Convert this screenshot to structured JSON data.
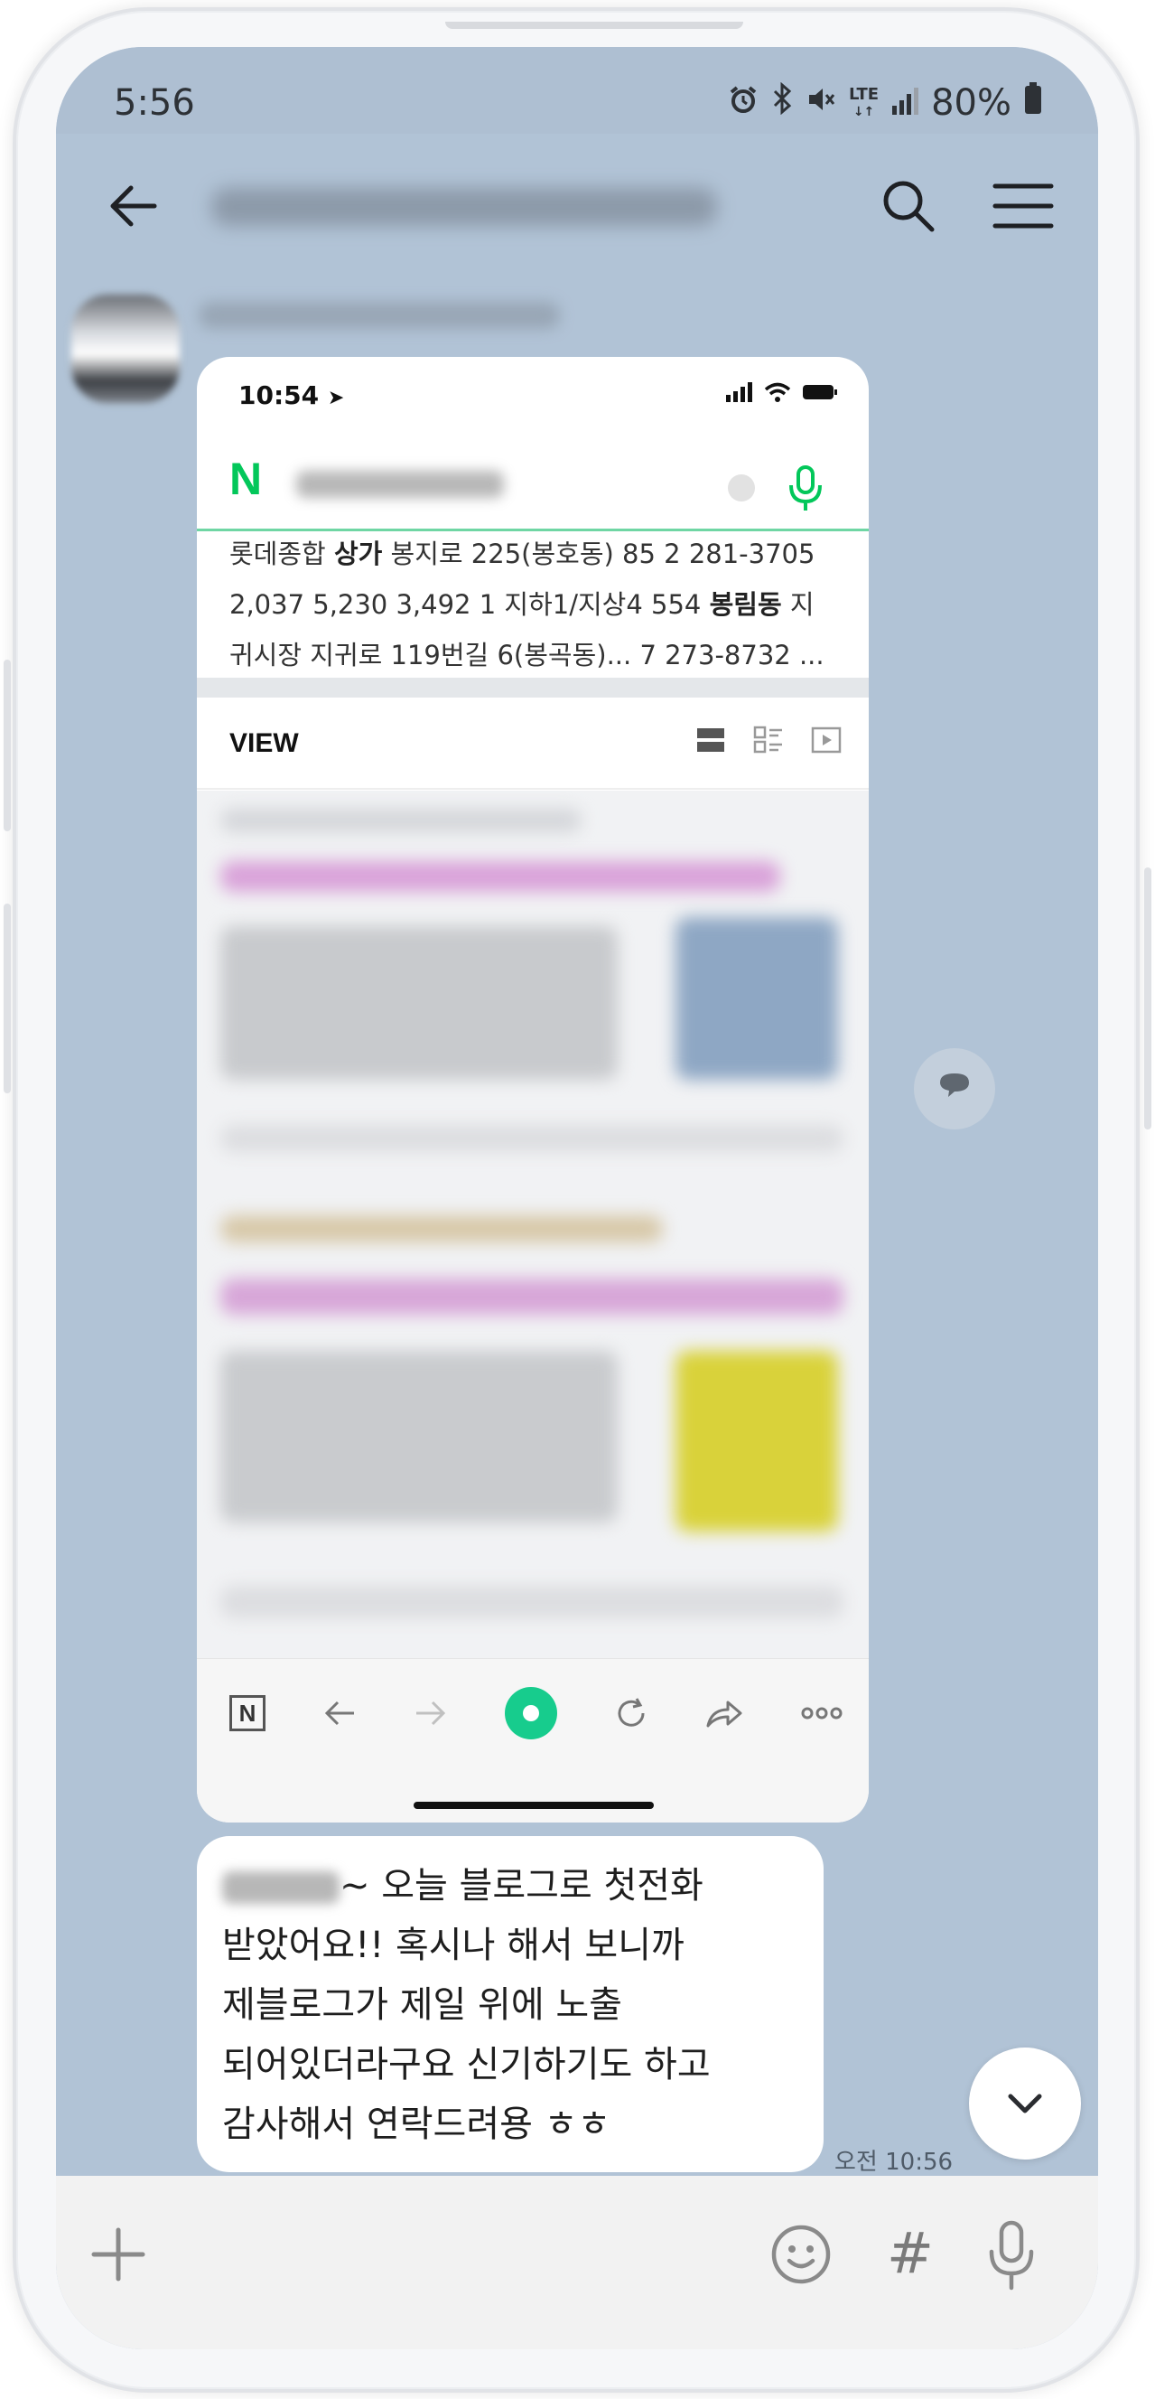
{
  "status_bar": {
    "time": "5:56",
    "network": "LTE",
    "battery": "80%"
  },
  "screenshot": {
    "status_time": "10:54",
    "search_logo": "N",
    "result_lines": [
      {
        "text_before": "롯데종합 ",
        "bold": "상가",
        "text_after": " 봉지로 225(봉호동) 85 2 281-3705"
      },
      {
        "text_before": "2,037 5,230 3,492 1 지하1/지상4 554 ",
        "bold": "봉림동",
        "text_after": " 지"
      },
      {
        "text_before": "귀시장 지귀로 119번길 6(봉곡동)... 7 273-8732 ...",
        "bold": "",
        "text_after": ""
      }
    ],
    "view_label": "VIEW",
    "bottom_logo": "N"
  },
  "message": {
    "lines": [
      "~ 오늘 블로그로 첫전화",
      "받았어요!! 혹시나 해서 보니까",
      "제블로그가 제일 위에 노출",
      "되어있더라구요 신기하기도 하고",
      "감사해서 연락드려용 ㅎㅎ"
    ],
    "timestamp": "오전 10:56"
  },
  "input_bar": {
    "hash_symbol": "#"
  },
  "icons": [
    "back-arrow-icon",
    "search-icon",
    "menu-icon",
    "comment-icon",
    "chevron-down-icon",
    "plus-icon",
    "emoji-icon",
    "hashtag-icon",
    "mic-icon"
  ],
  "colors": {
    "chat_background": "#b1c3d6",
    "naver_green": "#03c75a",
    "bubble": "#ffffff"
  }
}
